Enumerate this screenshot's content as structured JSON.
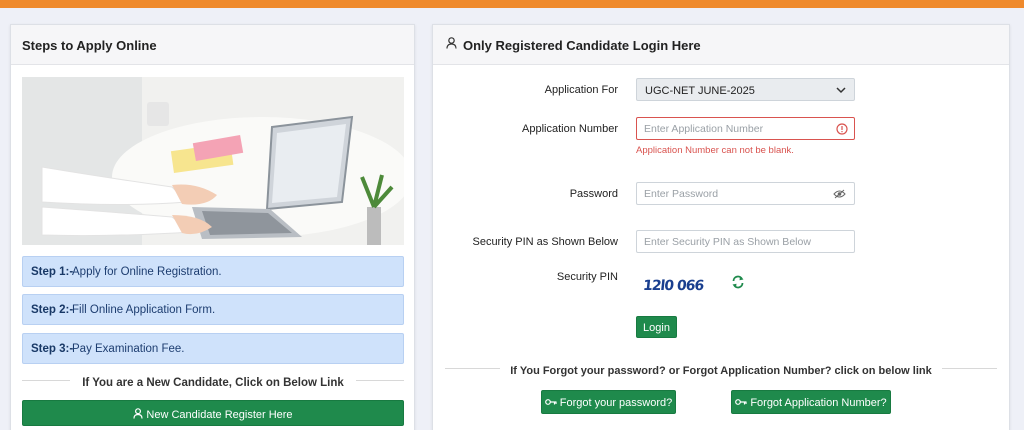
{
  "colors": {
    "accent": "#ef8a2c",
    "primary_button": "#1f8a4c",
    "step_bg": "#cfe2fb",
    "error": "#d9534f"
  },
  "steps_panel": {
    "title": "Steps to Apply Online",
    "steps": [
      {
        "num": "Step 1:-",
        "text": "Apply for Online Registration."
      },
      {
        "num": "Step 2:-",
        "text": "Fill Online Application Form."
      },
      {
        "num": "Step 3:-",
        "text": "Pay Examination Fee."
      }
    ],
    "new_candidate_text": "If You are a New Candidate, Click on Below Link",
    "register_button": "New Candidate Register Here",
    "register_icon": "user-icon"
  },
  "login_panel": {
    "title": "Only Registered Candidate Login Here",
    "title_icon": "user-icon",
    "application_for": {
      "label": "Application For",
      "value": "UGC-NET JUNE-2025"
    },
    "application_number": {
      "label": "Application Number",
      "placeholder": "Enter Application Number",
      "error": "Application Number can not be blank."
    },
    "password": {
      "label": "Password",
      "placeholder": "Enter Password"
    },
    "security_pin_input": {
      "label": "Security PIN as Shown Below",
      "placeholder": "Enter Security PIN as Shown Below"
    },
    "security_pin": {
      "label": "Security PIN",
      "code": "12l0 066"
    },
    "login_button": "Login",
    "forgot_text": "If You Forgot your password? or Forgot Application Number? click on below link",
    "forgot_password_button": "Forgot your password?",
    "forgot_application_button": "Forgot Application Number?"
  }
}
